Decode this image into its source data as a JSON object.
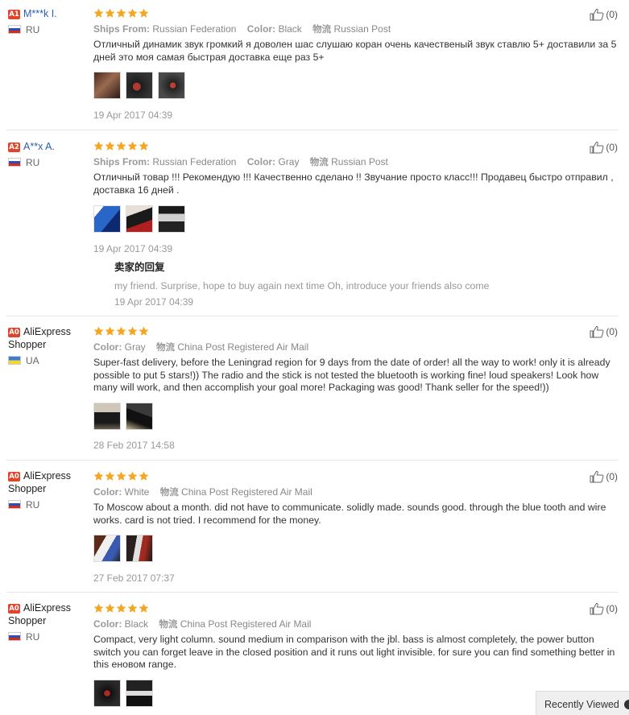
{
  "labels": {
    "ships_from": "Ships From:",
    "color": "Color:",
    "logistics": "物流",
    "reply_title": "卖家的回复"
  },
  "reviews": [
    {
      "level": "A1",
      "name": "M***k I.",
      "country": "RU",
      "flag": "ru",
      "ships_from": "Russian Federation",
      "color": "Black",
      "logistics": "Russian Post",
      "text": "Отличный динамик звук громкий я доволен шас слушаю коран очень качественый звук ставлю 5+ доставили за 5 дней это моя самая быстрая доставка еще раз 5+",
      "date": "19 Apr 2017 04:39",
      "helpful": "(0)"
    },
    {
      "level": "A2",
      "name": "A**x A.",
      "country": "RU",
      "flag": "ru",
      "ships_from": "Russian Federation",
      "color": "Gray",
      "logistics": "Russian Post",
      "text": "Отличный товар !!! Рекомендую !!! Качественно сделано !! Звучание просто класс!!! Продавец быстро отправил , доставка 16 дней .",
      "date": "19 Apr 2017 04:39",
      "helpful": "(0)",
      "reply": {
        "text": "my friend. Surprise, hope to buy again next time Oh, introduce your friends also come",
        "date": "19 Apr 2017 04:39"
      }
    },
    {
      "level": "A0",
      "name": "AliExpress Shopper",
      "country": "UA",
      "flag": "ua",
      "color": "Gray",
      "logistics": "China Post Registered Air Mail",
      "text": "Super-fast delivery, before the Leningrad region for 9 days from the date of order! all the way to work! only it is already possible to put 5 stars!)) The radio and the stick is not tested the bluetooth is working fine! loud speakers! Look how many will work, and then accomplish your goal more! Packaging was good! Thank seller for the speed!))",
      "date": "28 Feb 2017 14:58",
      "helpful": "(0)"
    },
    {
      "level": "A0",
      "name": "AliExpress Shopper",
      "country": "RU",
      "flag": "ru",
      "color": "White",
      "logistics": "China Post Registered Air Mail",
      "text": "To Moscow about a month. did not have to communicate. solidly made. sounds good. through the blue tooth and wire works. card is not tried. I recommend for the money.",
      "date": "27 Feb 2017 07:37",
      "helpful": "(0)"
    },
    {
      "level": "A0",
      "name": "AliExpress Shopper",
      "country": "RU",
      "flag": "ru",
      "color": "Black",
      "logistics": "China Post Registered Air Mail",
      "text": "Compact, very light column. sound medium in comparison with the jbl. bass is almost completely, the power button switch you can forget leave in the closed position and it runs out light invisible. for sure you can find something better in this еновом range.",
      "helpful": "(0)"
    }
  ],
  "rating": {
    "stars": 5,
    "max": 5
  },
  "recently_viewed": "Recently Viewed",
  "colors": {
    "star": "#f5a623",
    "link": "#2a5db0",
    "level_badge": "#e0452c"
  }
}
